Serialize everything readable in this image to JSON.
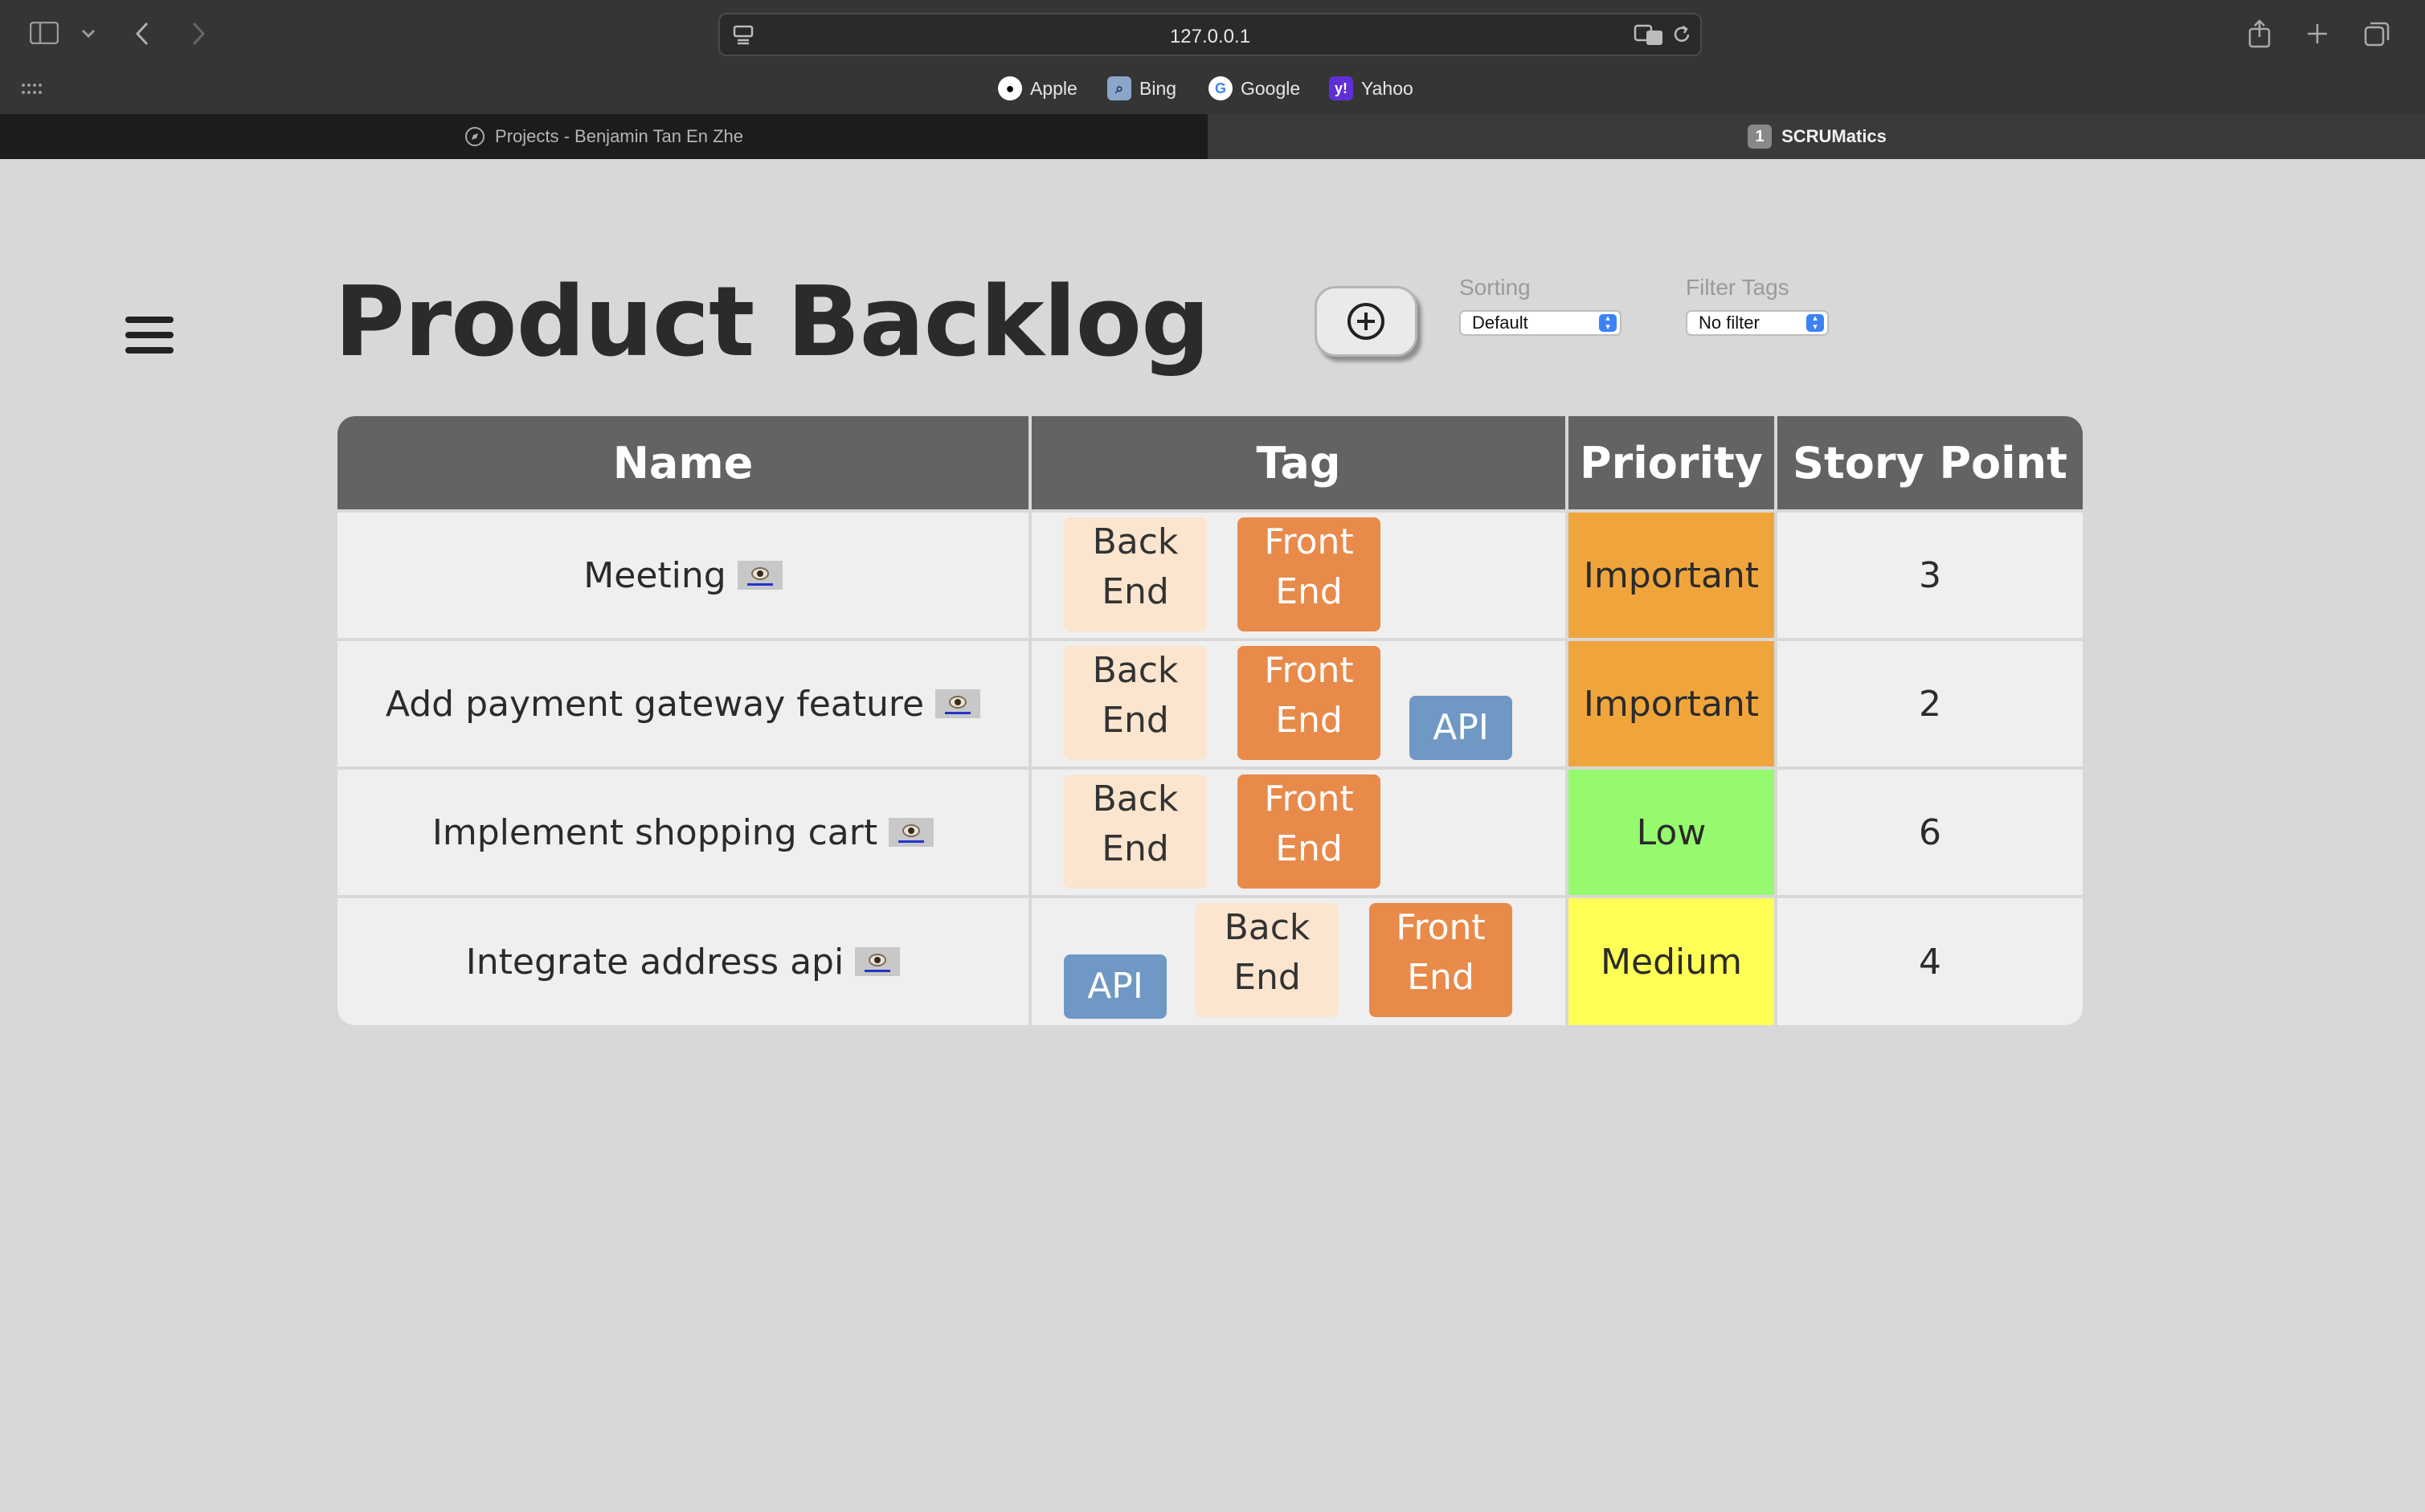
{
  "browser": {
    "address": "127.0.0.1",
    "favorites": [
      {
        "label": "Apple",
        "icon": "apple-icon"
      },
      {
        "label": "Bing",
        "icon": "bing-icon"
      },
      {
        "label": "Google",
        "icon": "google-icon"
      },
      {
        "label": "Yahoo",
        "icon": "yahoo-icon"
      }
    ],
    "tabs": [
      {
        "label": "Projects - Benjamin Tan En Zhe"
      },
      {
        "label": "SCRUMatics",
        "badge": "1"
      }
    ]
  },
  "page": {
    "title": "Product Backlog",
    "sorting": {
      "label": "Sorting",
      "value": "Default"
    },
    "filter": {
      "label": "Filter Tags",
      "value": "No filter"
    }
  },
  "table": {
    "headers": [
      "Name",
      "Tag",
      "Priority",
      "Story Point"
    ],
    "rows": [
      {
        "name": "Meeting",
        "tags": [
          "Back End",
          "Front End"
        ],
        "priority": "Important",
        "points": "3"
      },
      {
        "name": "Add payment gateway feature",
        "tags": [
          "Back End",
          "Front End",
          "API"
        ],
        "priority": "Important",
        "points": "2"
      },
      {
        "name": "Implement shopping cart",
        "tags": [
          "Back End",
          "Front End"
        ],
        "priority": "Low",
        "points": "6"
      },
      {
        "name": "Integrate address api",
        "tags": [
          "API",
          "Back End",
          "Front End"
        ],
        "priority": "Medium",
        "points": "4"
      }
    ]
  },
  "colors": {
    "important": "#f0a53c",
    "low": "#96fa6e",
    "medium": "#ffff55",
    "tag_back_end": "#fbe5ce",
    "tag_front_end": "#e88a4a",
    "tag_api": "#6f98c4",
    "header": "#636363"
  }
}
